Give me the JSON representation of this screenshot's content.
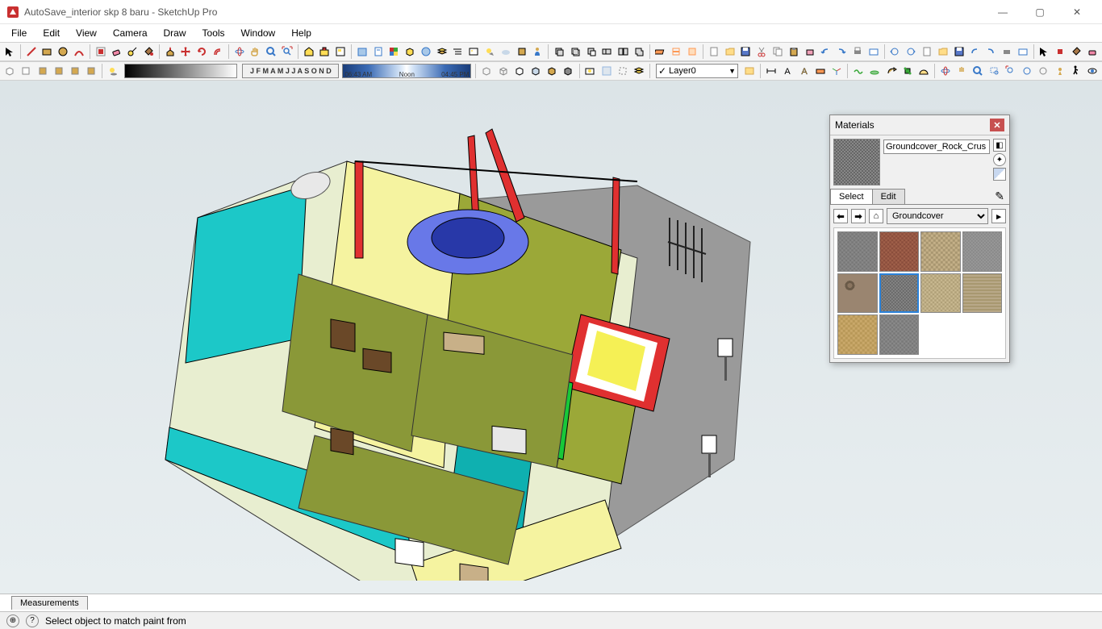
{
  "titlebar": {
    "title": "AutoSave_interior skp 8 baru - SketchUp Pro"
  },
  "menubar": {
    "items": [
      "File",
      "Edit",
      "View",
      "Camera",
      "Draw",
      "Tools",
      "Window",
      "Help"
    ]
  },
  "toolbar2": {
    "months": "J F M A M J J A S O N D",
    "time_left": "06:43 AM",
    "time_mid": "Noon",
    "time_right": "04:45 PM",
    "layer": "Layer0"
  },
  "materials": {
    "title": "Materials",
    "current_name": "Groundcover_Rock_Crus",
    "tab_select": "Select",
    "tab_edit": "Edit",
    "category": "Groundcover",
    "swatches": [
      {
        "bg": "repeating-conic-gradient(#888 0% 25%, #777 0% 50%) 50% / 5px 5px"
      },
      {
        "bg": "repeating-conic-gradient(#a0604a 0% 25%, #8a4d3c 0% 50%) 50% / 5px 5px"
      },
      {
        "bg": "repeating-conic-gradient(#c4b088 0% 25%, #a89670 0% 50%) 50% / 6px 6px"
      },
      {
        "bg": "repeating-conic-gradient(#999 0% 25%, #888 0% 50%) 50% / 4px 4px"
      },
      {
        "bg": "radial-gradient(circle at 30% 30%, #8a7560 3px, #6a5a48 3px 6px, #9a8570 6px)"
      },
      {
        "bg": "repeating-conic-gradient(#888 0% 25%, #666 0% 50%) 50% / 4px 4px",
        "selected": true
      },
      {
        "bg": "repeating-conic-gradient(#c8b890 0% 25%, #b0a078 0% 50%) 50% / 5px 5px"
      },
      {
        "bg": "repeating-linear-gradient(0deg, #b8a888 0 2px, #a89870 2px 4px)"
      },
      {
        "bg": "repeating-conic-gradient(#c9a86a 0% 25%, #b89858 0% 50%) 50% / 6px 6px"
      },
      {
        "bg": "repeating-conic-gradient(#8a8a8a 0% 25%, #787878 0% 50%) 50% / 5px 5px"
      }
    ]
  },
  "statusbar": {
    "tab": "Measurements",
    "hint": "Select object to match paint from"
  }
}
